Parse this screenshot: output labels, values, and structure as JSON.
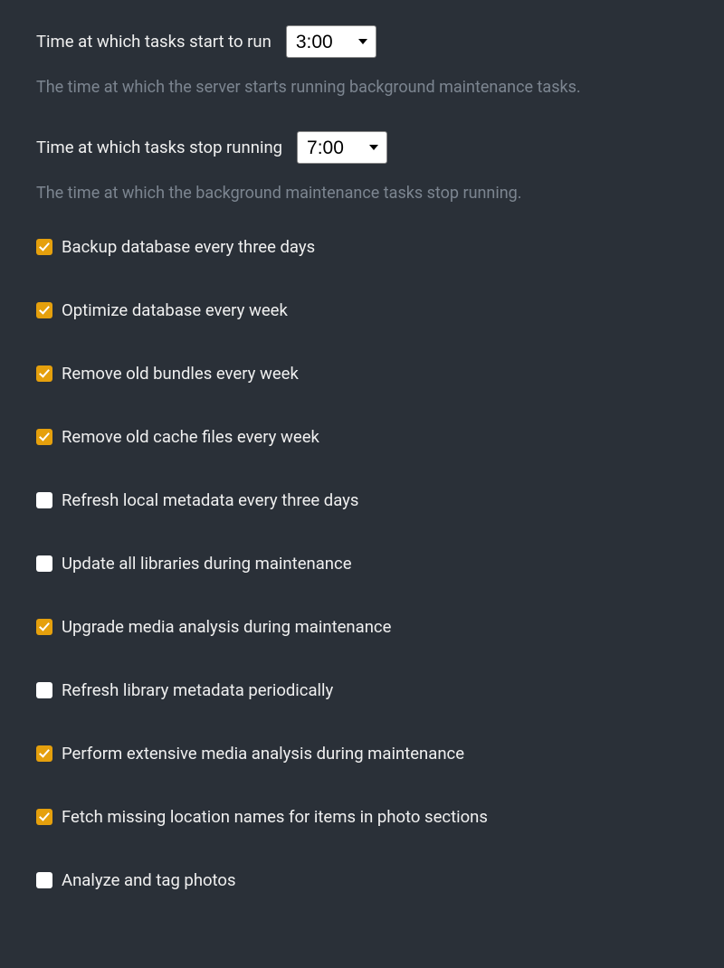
{
  "start": {
    "label": "Time at which tasks start to run",
    "value": "3:00",
    "help": "The time at which the server starts running background maintenance tasks."
  },
  "stop": {
    "label": "Time at which tasks stop running",
    "value": "7:00",
    "help": "The time at which the background maintenance tasks stop running."
  },
  "tasks": [
    {
      "id": "backup-db",
      "label": "Backup database every three days",
      "checked": true
    },
    {
      "id": "optimize-db",
      "label": "Optimize database every week",
      "checked": true
    },
    {
      "id": "remove-bundles",
      "label": "Remove old bundles every week",
      "checked": true
    },
    {
      "id": "remove-cache",
      "label": "Remove old cache files every week",
      "checked": true
    },
    {
      "id": "refresh-local-meta",
      "label": "Refresh local metadata every three days",
      "checked": false
    },
    {
      "id": "update-libraries",
      "label": "Update all libraries during maintenance",
      "checked": false
    },
    {
      "id": "upgrade-media",
      "label": "Upgrade media analysis during maintenance",
      "checked": true
    },
    {
      "id": "refresh-lib-meta",
      "label": "Refresh library metadata periodically",
      "checked": false
    },
    {
      "id": "extensive-media",
      "label": "Perform extensive media analysis during maintenance",
      "checked": true
    },
    {
      "id": "fetch-location",
      "label": "Fetch missing location names for items in photo sections",
      "checked": true
    },
    {
      "id": "analyze-tag-photos",
      "label": "Analyze and tag photos",
      "checked": false
    }
  ]
}
